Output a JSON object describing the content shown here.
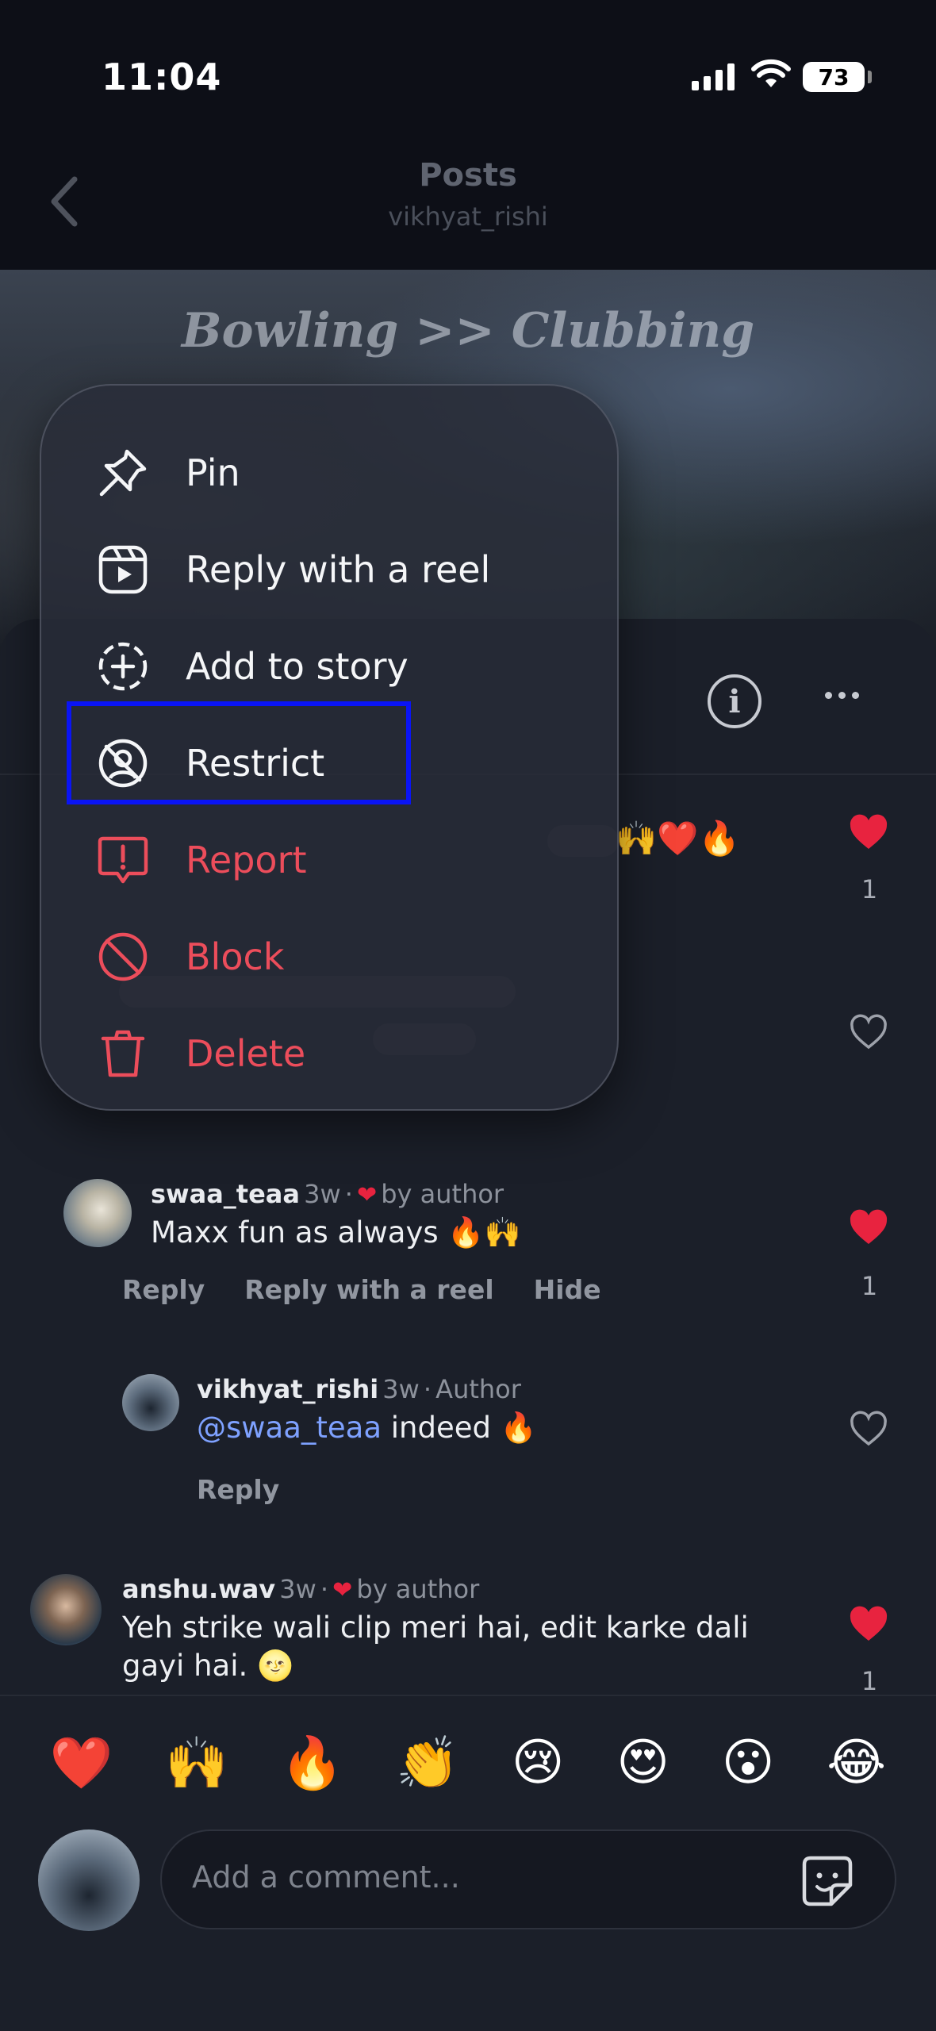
{
  "status_bar": {
    "time": "11:04",
    "battery": "73"
  },
  "header": {
    "title": "Posts",
    "subtitle": "vikhyat_rishi"
  },
  "photo": {
    "overlay_text": "Bowling >> Clubbing"
  },
  "context_menu": {
    "items": [
      {
        "label": "Pin",
        "icon": "pin-icon",
        "tone": "white"
      },
      {
        "label": "Reply with a reel",
        "icon": "reel-icon",
        "tone": "white"
      },
      {
        "label": "Add to story",
        "icon": "add-story-icon",
        "tone": "white"
      },
      {
        "label": "Restrict",
        "icon": "restrict-icon",
        "tone": "white",
        "highlighted": true
      },
      {
        "label": "Report",
        "icon": "report-icon",
        "tone": "red"
      },
      {
        "label": "Block",
        "icon": "block-icon",
        "tone": "red"
      },
      {
        "label": "Delete",
        "icon": "trash-icon",
        "tone": "red"
      }
    ]
  },
  "first_comment": {
    "likes": "1"
  },
  "comments": [
    {
      "username": "swaa_teaa",
      "age": "3w",
      "liked_by": "by author",
      "text": "Maxx fun as always 🔥🙌",
      "likes": "1",
      "actions": [
        "Reply",
        "Reply with a reel",
        "Hide"
      ]
    },
    {
      "username": "vikhyat_rishi",
      "age": "3w",
      "badge": "Author",
      "mention": "@swaa_teaa",
      "text": "indeed 🔥",
      "actions": [
        "Reply"
      ]
    },
    {
      "username": "anshu.wav",
      "age": "3w",
      "liked_by": "by author",
      "text": "Yeh strike wali clip meri hai, edit karke dali gayi hai. 🌝",
      "likes": "1"
    }
  ],
  "reactions": [
    "❤️",
    "🙌",
    "🔥",
    "👏",
    "😢",
    "😍",
    "😮",
    "😂"
  ],
  "comment_input": {
    "placeholder": "Add a comment..."
  },
  "colors": {
    "accent_red": "#ec4d5b",
    "highlight_box": "#0a14f5",
    "heart": "#e8233f",
    "mention": "#7ea1ff"
  }
}
